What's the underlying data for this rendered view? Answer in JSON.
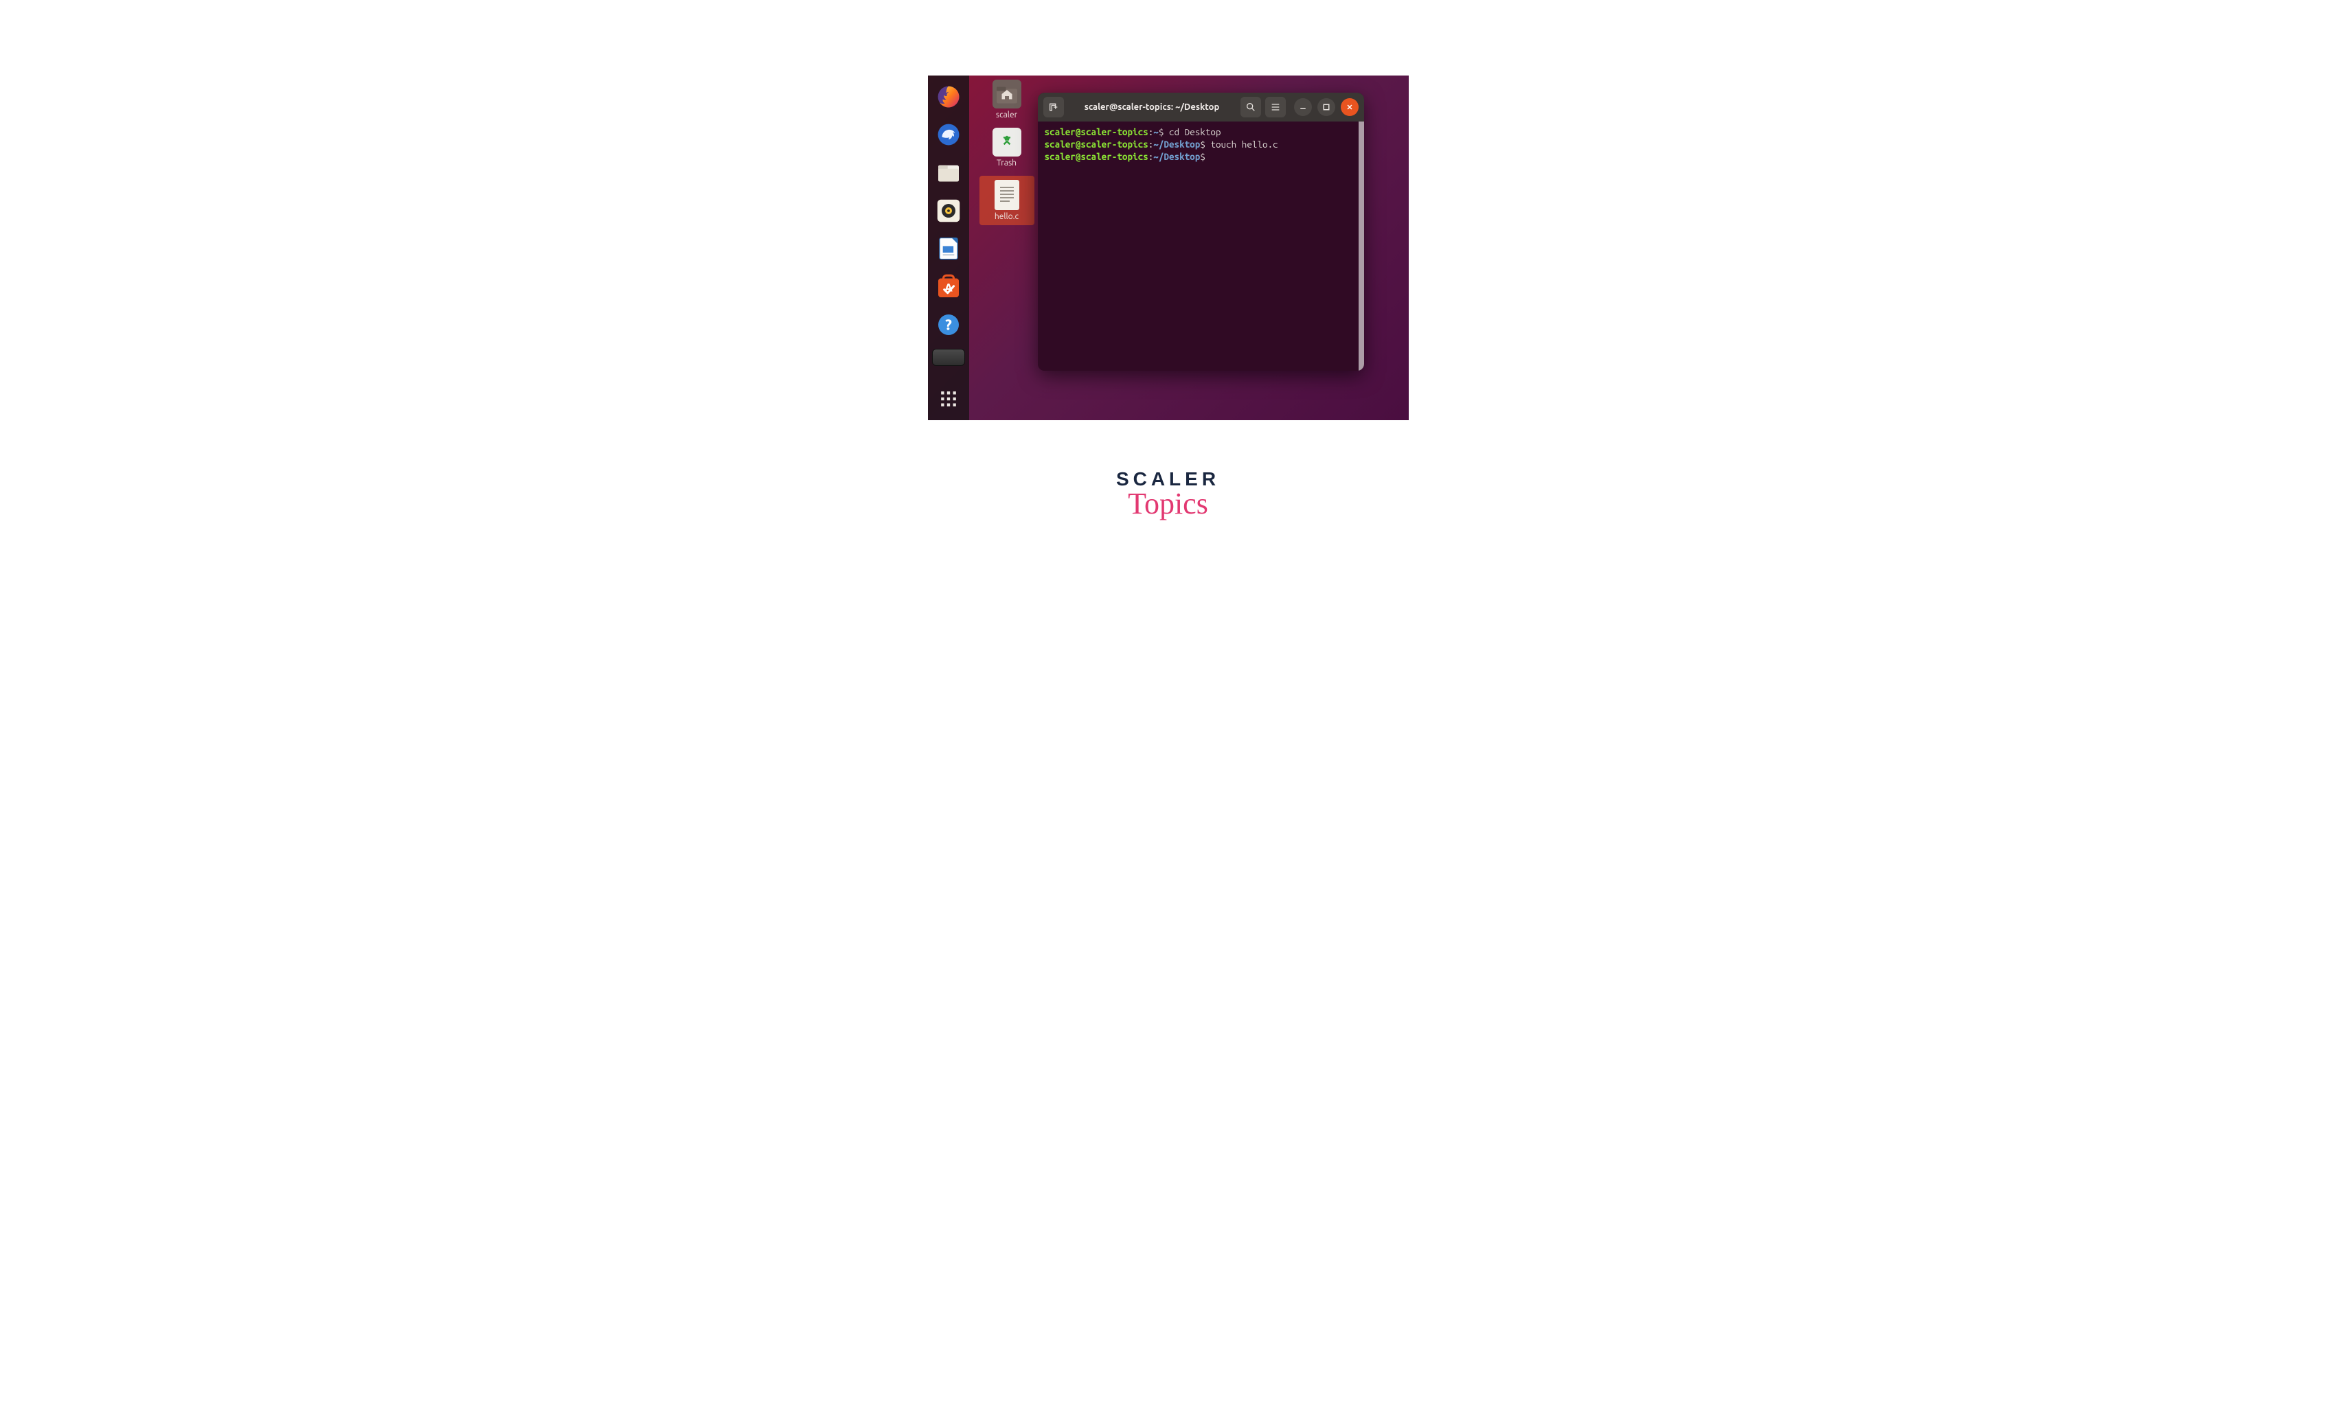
{
  "window": {
    "title": "scaler@scaler-topics: ~/Desktop"
  },
  "dock": {
    "items": [
      {
        "name": "firefox"
      },
      {
        "name": "thunderbird"
      },
      {
        "name": "files"
      },
      {
        "name": "rhythmbox"
      },
      {
        "name": "libreoffice-writer"
      },
      {
        "name": "ubuntu-software"
      },
      {
        "name": "help"
      }
    ],
    "running": "terminal",
    "apps_button": "show-applications"
  },
  "desktop_icons": [
    {
      "label": "scaler",
      "kind": "home-folder"
    },
    {
      "label": "Trash",
      "kind": "trash"
    },
    {
      "label": "hello.c",
      "kind": "text-file",
      "selected": true
    }
  ],
  "terminal": {
    "lines": [
      {
        "user": "scaler@scaler-topics",
        "sep": ":",
        "path": "~",
        "prompt": "$",
        "command": "cd Desktop"
      },
      {
        "user": "scaler@scaler-topics",
        "sep": ":",
        "path": "~/Desktop",
        "prompt": "$",
        "command": "touch hello.c"
      },
      {
        "user": "scaler@scaler-topics",
        "sep": ":",
        "path": "~/Desktop",
        "prompt": "$",
        "command": ""
      }
    ]
  },
  "logo": {
    "top": "SCALER",
    "bottom": "Topics"
  },
  "colors": {
    "accent_orange": "#e95420",
    "terminal_bg": "#300a24",
    "prompt_green": "#8ae234",
    "prompt_blue": "#729fcf",
    "logo_navy": "#1a2740",
    "logo_pink": "#e23871"
  }
}
